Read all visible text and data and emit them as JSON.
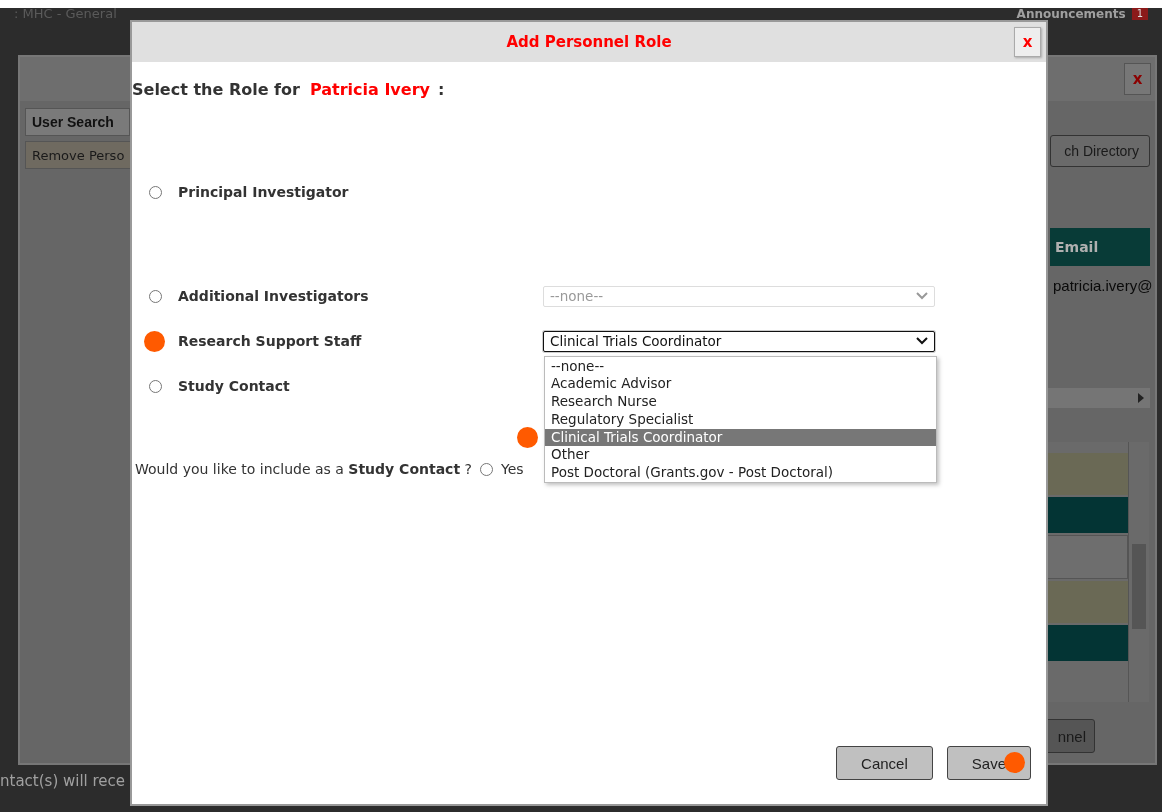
{
  "background_page": {
    "header_text": ":  MHC - General",
    "announcements": {
      "label": "Announcements",
      "count": "1"
    },
    "footer_text": "ntact(s) will rece"
  },
  "back_dialog": {
    "close_label": "x",
    "tab": "User Search",
    "remove_button": "Remove Perso",
    "directory_button": "ch Directory",
    "column_header": "Email",
    "email_cell": "patricia.ivery@",
    "personnel_button": "nnel"
  },
  "dialog": {
    "title": "Add Personnel Role",
    "close_label": "x",
    "prompt": "Select the Role for",
    "person": "Patricia Ivery",
    "prompt_end": ":",
    "roles": [
      {
        "label": "Principal Investigator",
        "selected": false
      },
      {
        "label": "Additional Investigators",
        "selected": false,
        "dropdown": {
          "value": "--none--",
          "disabled": true
        }
      },
      {
        "label": "Research Support Staff",
        "marked": true,
        "dropdown": {
          "value": "Clinical Trials Coordinator",
          "disabled": false,
          "expanded": true,
          "options": [
            {
              "label": "--none--",
              "selected": false
            },
            {
              "label": "Academic Advisor",
              "selected": false
            },
            {
              "label": "Research Nurse",
              "selected": false
            },
            {
              "label": "Regulatory Specialist",
              "selected": false
            },
            {
              "label": "Clinical Trials Coordinator",
              "selected": true,
              "marked": true
            },
            {
              "label": "Other",
              "selected": false
            },
            {
              "label": "Post Doctoral (Grants.gov - Post Doctoral)",
              "selected": false
            }
          ]
        }
      },
      {
        "label": "Study Contact",
        "selected": false
      }
    ],
    "study_contact_question": "Would you like to include as a **Study Contact** ?",
    "study_contact_option": {
      "label": "Yes",
      "selected": false
    },
    "buttons": [
      {
        "label": "Cancel"
      },
      {
        "label": "Save",
        "marked": true
      }
    ]
  }
}
